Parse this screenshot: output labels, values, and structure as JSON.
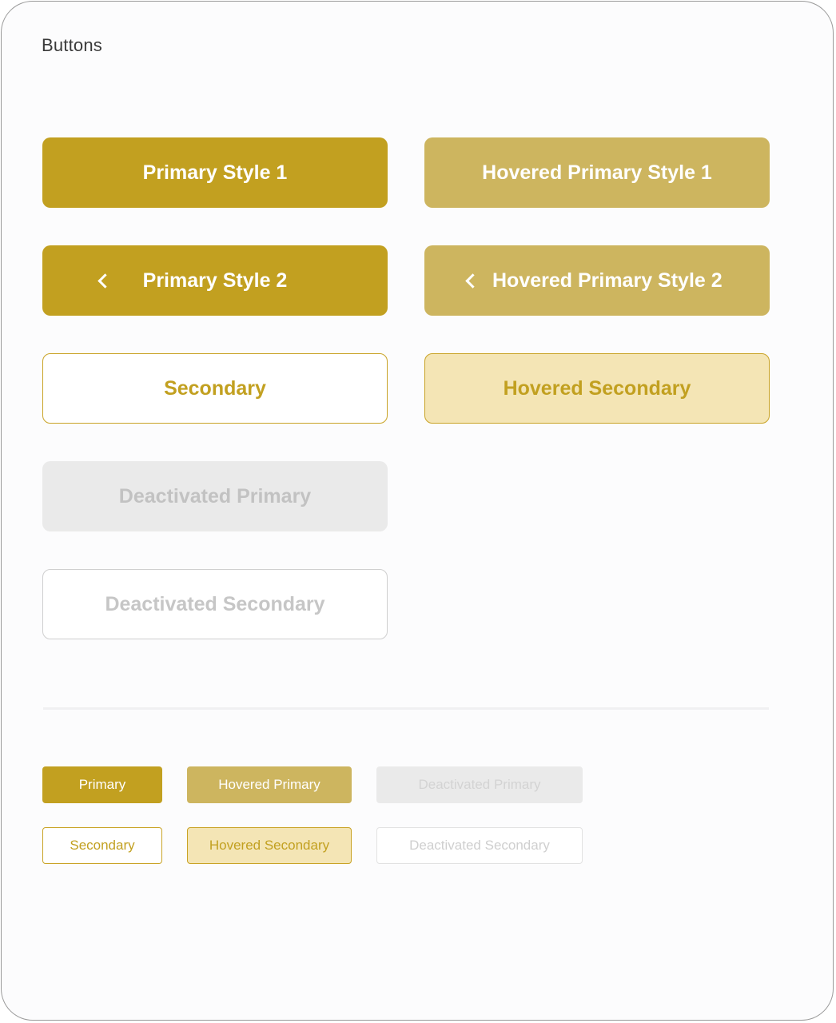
{
  "page": {
    "title": "Buttons"
  },
  "large_buttons": {
    "primary_style_1": "Primary Style 1",
    "hovered_primary_style_1": "Hovered Primary Style 1",
    "primary_style_2": "Primary Style 2",
    "hovered_primary_style_2": "Hovered Primary Style 2",
    "secondary": "Secondary",
    "hovered_secondary": "Hovered Secondary",
    "deactivated_primary": "Deactivated Primary",
    "deactivated_secondary": "Deactivated Secondary"
  },
  "small_buttons": {
    "primary": "Primary",
    "hovered_primary": "Hovered Primary",
    "deactivated_primary": "Deactivated Primary",
    "secondary": "Secondary",
    "hovered_secondary": "Hovered Secondary",
    "deactivated_secondary": "Deactivated Secondary"
  },
  "icons": {
    "back": "chevron-left-icon"
  },
  "colors": {
    "primary": "#c2a020",
    "primary_hover": "#cdb55f",
    "secondary_hover_fill": "#f4e5b5",
    "disabled_fill": "#eaeaea",
    "disabled_text": "#c2c2c2"
  }
}
